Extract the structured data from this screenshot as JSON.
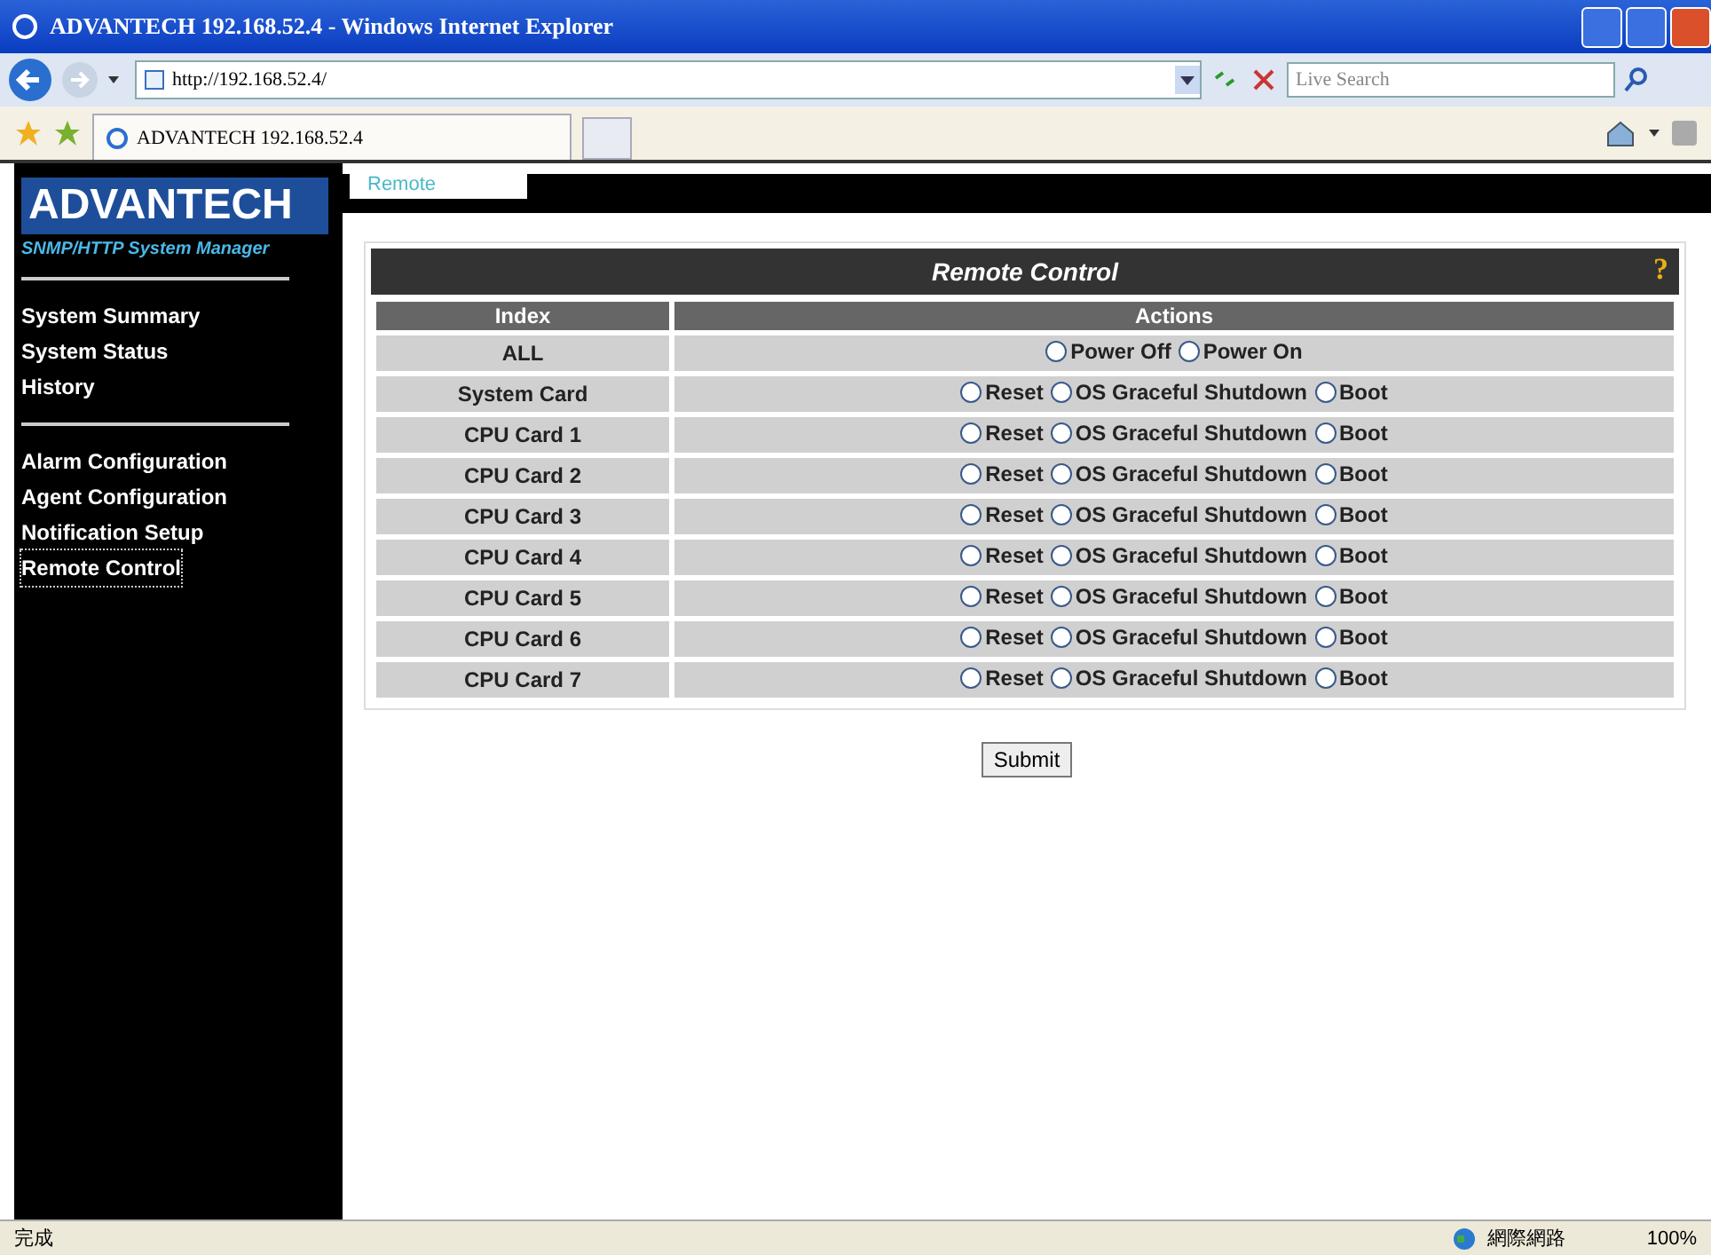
{
  "window": {
    "title": "ADVANTECH 192.168.52.4 - Windows Internet Explorer"
  },
  "address_bar": {
    "url": "http://192.168.52.4/"
  },
  "search": {
    "placeholder": "Live Search"
  },
  "browser_tab": {
    "title": "ADVANTECH 192.168.52.4"
  },
  "sidebar": {
    "logo": "ADVANTECH",
    "subtitle": "SNMP/HTTP System Manager",
    "groups": [
      [
        {
          "label": "System Summary",
          "selected": false
        },
        {
          "label": "System Status",
          "selected": false
        },
        {
          "label": "History",
          "selected": false
        }
      ],
      [
        {
          "label": "Alarm Configuration",
          "selected": false
        },
        {
          "label": "Agent Configuration",
          "selected": false
        },
        {
          "label": "Notification Setup",
          "selected": false
        },
        {
          "label": "Remote Control",
          "selected": true
        }
      ]
    ]
  },
  "page_tabs": [
    {
      "label": "Remote",
      "selected": true
    }
  ],
  "panel": {
    "title": "Remote Control",
    "help": "?"
  },
  "table": {
    "columns": [
      "Index",
      "Actions"
    ],
    "rows": [
      {
        "index": "ALL",
        "options": [
          {
            "label": "Power Off",
            "selected": false
          },
          {
            "label": "Power On",
            "selected": false
          }
        ]
      },
      {
        "index": "System Card",
        "options": [
          {
            "label": "Reset",
            "selected": false
          },
          {
            "label": "OS Graceful Shutdown",
            "selected": false
          },
          {
            "label": "Boot",
            "selected": false
          }
        ]
      },
      {
        "index": "CPU Card 1",
        "options": [
          {
            "label": "Reset",
            "selected": false
          },
          {
            "label": "OS Graceful Shutdown",
            "selected": false
          },
          {
            "label": "Boot",
            "selected": false
          }
        ]
      },
      {
        "index": "CPU Card 2",
        "options": [
          {
            "label": "Reset",
            "selected": false
          },
          {
            "label": "OS Graceful Shutdown",
            "selected": false
          },
          {
            "label": "Boot",
            "selected": false
          }
        ]
      },
      {
        "index": "CPU Card 3",
        "options": [
          {
            "label": "Reset",
            "selected": false
          },
          {
            "label": "OS Graceful Shutdown",
            "selected": false
          },
          {
            "label": "Boot",
            "selected": false
          }
        ]
      },
      {
        "index": "CPU Card 4",
        "options": [
          {
            "label": "Reset",
            "selected": false
          },
          {
            "label": "OS Graceful Shutdown",
            "selected": false
          },
          {
            "label": "Boot",
            "selected": false
          }
        ]
      },
      {
        "index": "CPU Card 5",
        "options": [
          {
            "label": "Reset",
            "selected": false
          },
          {
            "label": "OS Graceful Shutdown",
            "selected": false
          },
          {
            "label": "Boot",
            "selected": false
          }
        ]
      },
      {
        "index": "CPU Card 6",
        "options": [
          {
            "label": "Reset",
            "selected": false
          },
          {
            "label": "OS Graceful Shutdown",
            "selected": false
          },
          {
            "label": "Boot",
            "selected": false
          }
        ]
      },
      {
        "index": "CPU Card 7",
        "options": [
          {
            "label": "Reset",
            "selected": false
          },
          {
            "label": "OS Graceful Shutdown",
            "selected": false
          },
          {
            "label": "Boot",
            "selected": false
          }
        ]
      }
    ]
  },
  "submit": "Submit",
  "status_bar": {
    "text": "完成",
    "zone": "網際網路",
    "zoom": "100%"
  }
}
